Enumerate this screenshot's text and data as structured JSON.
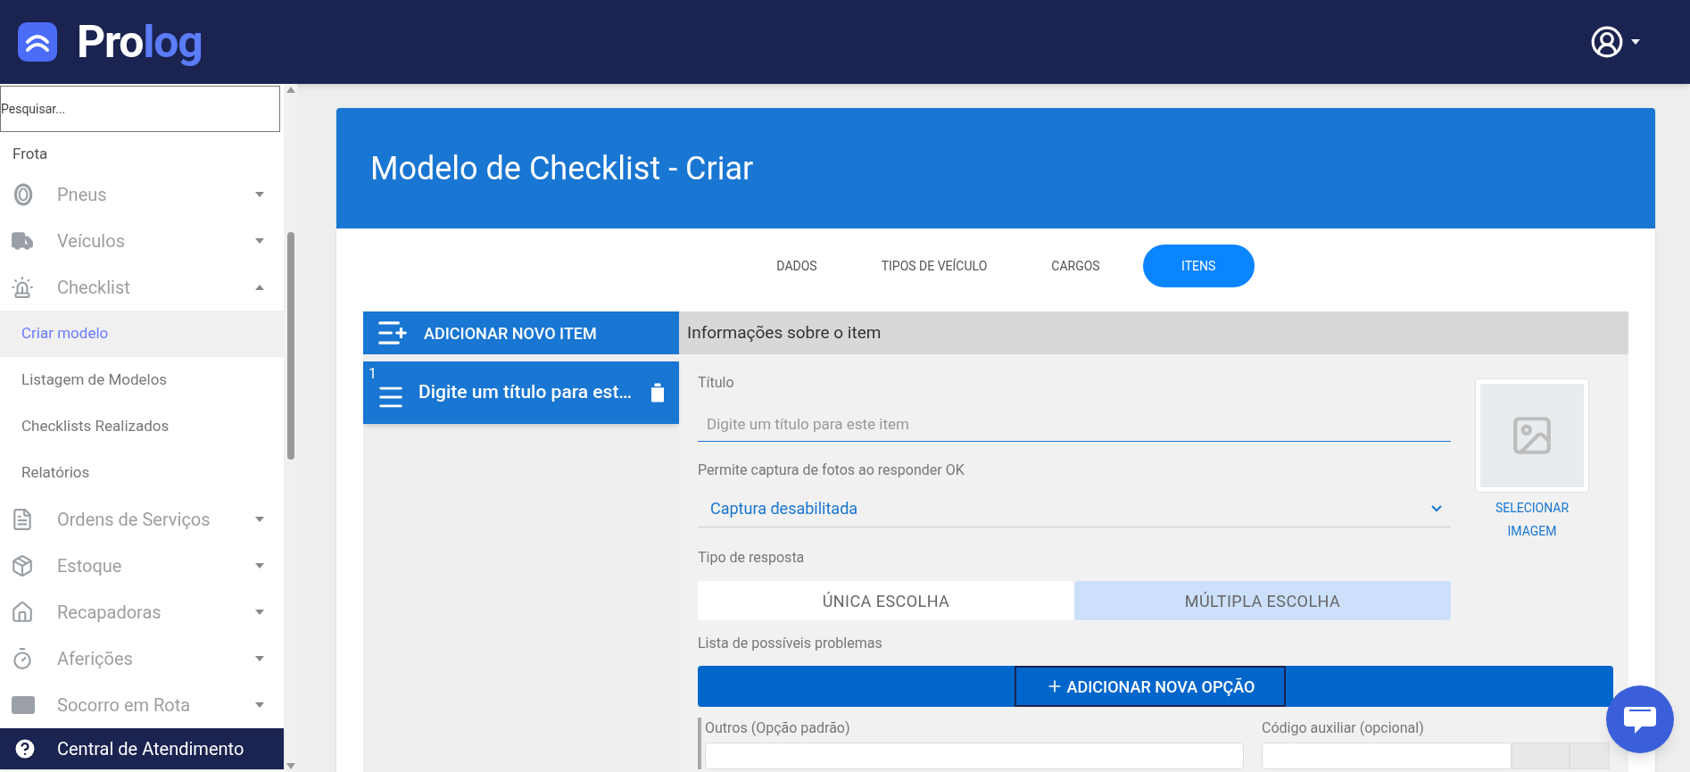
{
  "header": {
    "logo": {
      "part1": "Pro",
      "part2": "log"
    }
  },
  "sidebar": {
    "search": {
      "placeholder": "Pesquisar..."
    },
    "section": "Frota",
    "items": [
      {
        "label": "Pneus",
        "expanded": false
      },
      {
        "label": "Veículos",
        "expanded": false
      },
      {
        "label": "Checklist",
        "expanded": true,
        "children": [
          {
            "label": "Criar modelo",
            "selected": true
          },
          {
            "label": "Listagem de Modelos",
            "selected": false
          },
          {
            "label": "Checklists Realizados",
            "selected": false
          },
          {
            "label": "Relatórios",
            "selected": false
          }
        ]
      },
      {
        "label": "Ordens de Serviços",
        "expanded": false
      },
      {
        "label": "Estoque",
        "expanded": false
      },
      {
        "label": "Recapadoras",
        "expanded": false
      },
      {
        "label": "Aferições",
        "expanded": false
      },
      {
        "label": "Socorro em Rota",
        "expanded": false
      }
    ],
    "help": "Central de Atendimento"
  },
  "page": {
    "title": "Modelo de Checklist - Criar",
    "tabs": [
      {
        "label": "DADOS",
        "selected": false
      },
      {
        "label": "TIPOS DE VEÍCULO",
        "selected": false
      },
      {
        "label": "CARGOS",
        "selected": false
      },
      {
        "label": "ITENS",
        "selected": true
      }
    ],
    "add_item": "ADICIONAR NOVO ITEM",
    "items": [
      {
        "number": "1",
        "title": "Digite um título para est…"
      }
    ],
    "details": {
      "heading": "Informações sobre o item",
      "title_field": {
        "label": "Título",
        "placeholder": "Digite um título para este item"
      },
      "photo_capture": {
        "label": "Permite captura de fotos ao responder OK",
        "value": "Captura desabilitada"
      },
      "response_type": {
        "label": "Tipo de resposta",
        "options": [
          {
            "label": "ÚNICA ESCOLHA",
            "selected": false
          },
          {
            "label": "MÚLTIPLA ESCOLHA",
            "selected": true
          }
        ]
      },
      "problems": {
        "label": "Lista de possíveis problemas",
        "add_button": "ADICIONAR NOVA OPÇÃO",
        "option_label": "Outros (Opção padrão)",
        "aux_code_label": "Código auxiliar (opcional)"
      },
      "image": {
        "button": "SELECIONAR IMAGEM"
      }
    }
  }
}
